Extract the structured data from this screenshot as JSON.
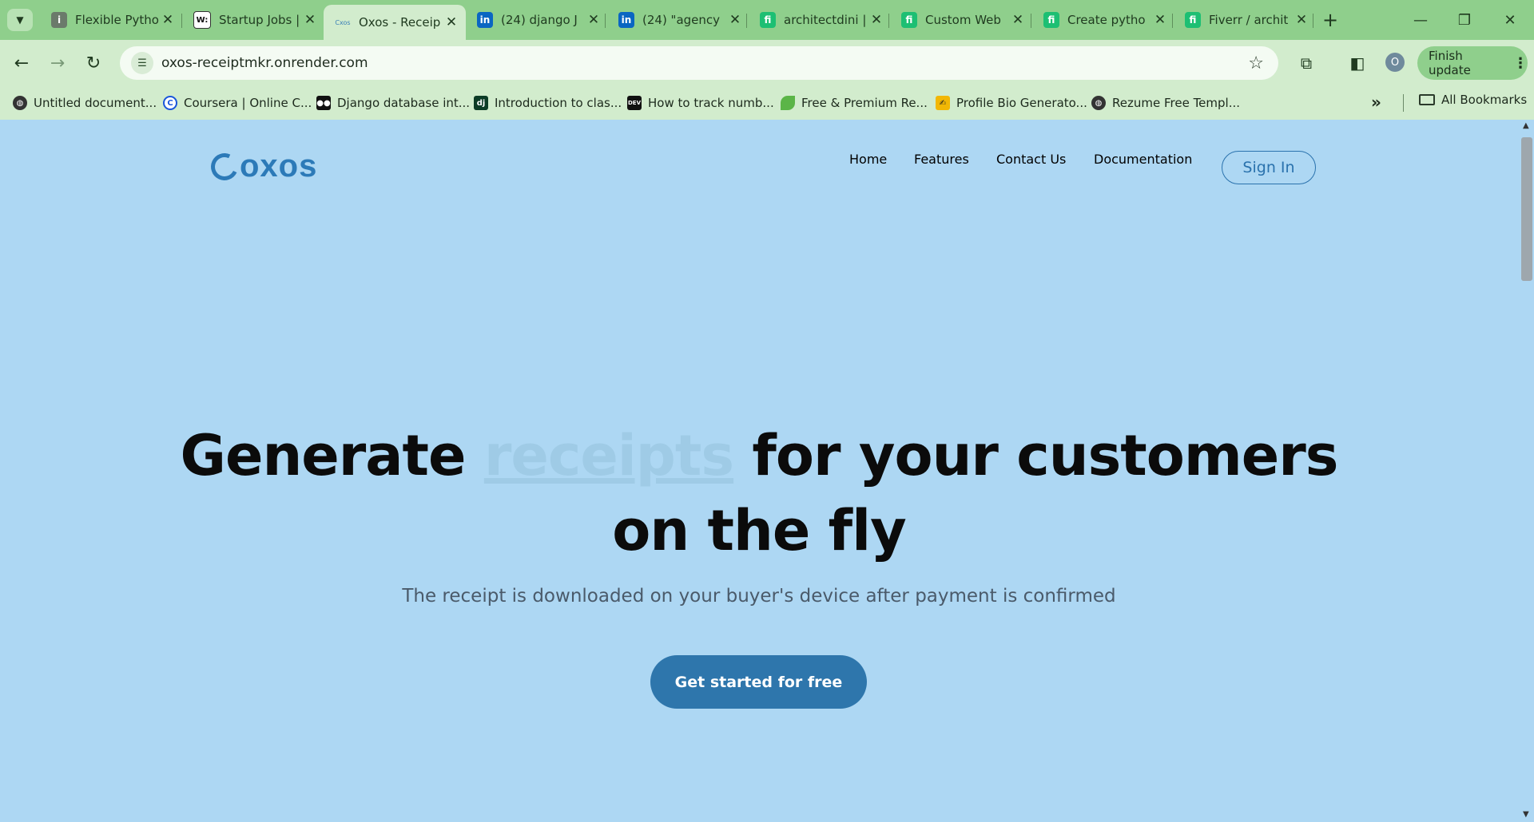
{
  "browser": {
    "tabs": [
      {
        "title": "Flexible Pytho",
        "favicon": "generic-icon",
        "active": false
      },
      {
        "title": "Startup Jobs |",
        "favicon": "w-icon",
        "active": false
      },
      {
        "title": "Oxos - Receip",
        "favicon": "oxos-icon",
        "active": true
      },
      {
        "title": "(24) django J",
        "favicon": "linkedin-icon",
        "active": false
      },
      {
        "title": "(24) \"agency",
        "favicon": "linkedin-icon",
        "active": false
      },
      {
        "title": "architectdini |",
        "favicon": "fiverr-icon",
        "active": false
      },
      {
        "title": "Custom Web",
        "favicon": "fiverr-icon",
        "active": false
      },
      {
        "title": "Create pytho",
        "favicon": "fiverr-icon",
        "active": false
      },
      {
        "title": "Fiverr / archit",
        "favicon": "fiverr-icon",
        "active": false
      }
    ],
    "url": "oxos-receiptmkr.onrender.com",
    "profile_initial": "O",
    "finish_update_label": "Finish update",
    "bookmarks": [
      {
        "label": "Untitled document...",
        "icon": "globe-icon"
      },
      {
        "label": "Coursera | Online C...",
        "icon": "coursera-icon"
      },
      {
        "label": "Django database int...",
        "icon": "medium-icon"
      },
      {
        "label": "Introduction to clas...",
        "icon": "dj-icon"
      },
      {
        "label": "How to track numb...",
        "icon": "dev-icon"
      },
      {
        "label": "Free & Premium Re...",
        "icon": "leaf-icon"
      },
      {
        "label": "Profile Bio Generato...",
        "icon": "pen-icon"
      },
      {
        "label": "Rezume Free Templ...",
        "icon": "globe-icon"
      }
    ],
    "all_bookmarks_label": "All Bookmarks"
  },
  "site": {
    "logo_text": "oxos",
    "nav": [
      "Home",
      "Features",
      "Contact Us",
      "Documentation"
    ],
    "signin_label": "Sign In",
    "hero": {
      "part1": "Generate",
      "highlight": "receipts",
      "part2": "for your customers",
      "line2": "on the fly"
    },
    "subtitle": "The receipt is downloaded on your buyer's device after payment is confirmed",
    "cta_label": "Get started for free"
  },
  "colors": {
    "page_bg": "#add7f3",
    "brand": "#2c7ab8",
    "cta": "#2e76ac",
    "chrome": "#8fcf8c"
  }
}
